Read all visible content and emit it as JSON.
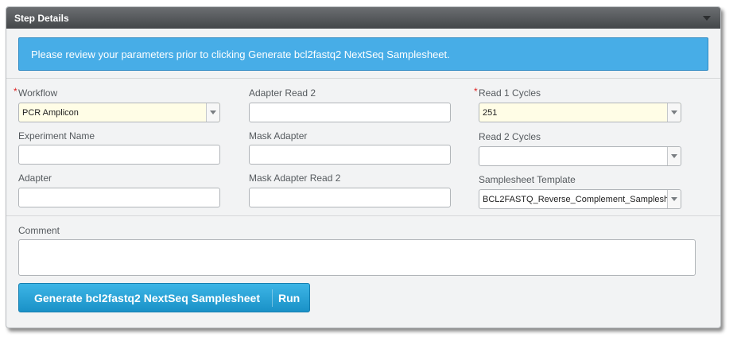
{
  "panel": {
    "title": "Step Details"
  },
  "banner": {
    "text": "Please review your parameters prior to clicking Generate bcl2fastq2 NextSeq Samplesheet."
  },
  "fields": {
    "workflow": {
      "label": "Workflow",
      "value": "PCR Amplicon",
      "required": "*"
    },
    "experiment_name": {
      "label": "Experiment Name",
      "value": ""
    },
    "adapter": {
      "label": "Adapter",
      "value": ""
    },
    "adapter_read2": {
      "label": "Adapter Read 2",
      "value": ""
    },
    "mask_adapter": {
      "label": "Mask Adapter",
      "value": ""
    },
    "mask_adapter_read2": {
      "label": "Mask Adapter Read 2",
      "value": ""
    },
    "read1_cycles": {
      "label": "Read 1 Cycles",
      "value": "251",
      "required": "*"
    },
    "read2_cycles": {
      "label": "Read 2 Cycles",
      "value": ""
    },
    "samplesheet_template": {
      "label": "Samplesheet Template",
      "value": "BCL2FASTQ_Reverse_Complement_Sampleshe"
    },
    "comment": {
      "label": "Comment",
      "value": ""
    }
  },
  "actions": {
    "generate_label": "Generate bcl2fastq2 NextSeq Samplesheet",
    "run_label": "Run"
  },
  "colors": {
    "header": "#55585b",
    "banner": "#47ade7",
    "button": "#2aa3d8",
    "required": "#e02424",
    "highlight_field": "#fffde6"
  },
  "icons": {
    "collapse": "chevron-down-icon",
    "dropdown": "dropdown-arrow-icon"
  }
}
